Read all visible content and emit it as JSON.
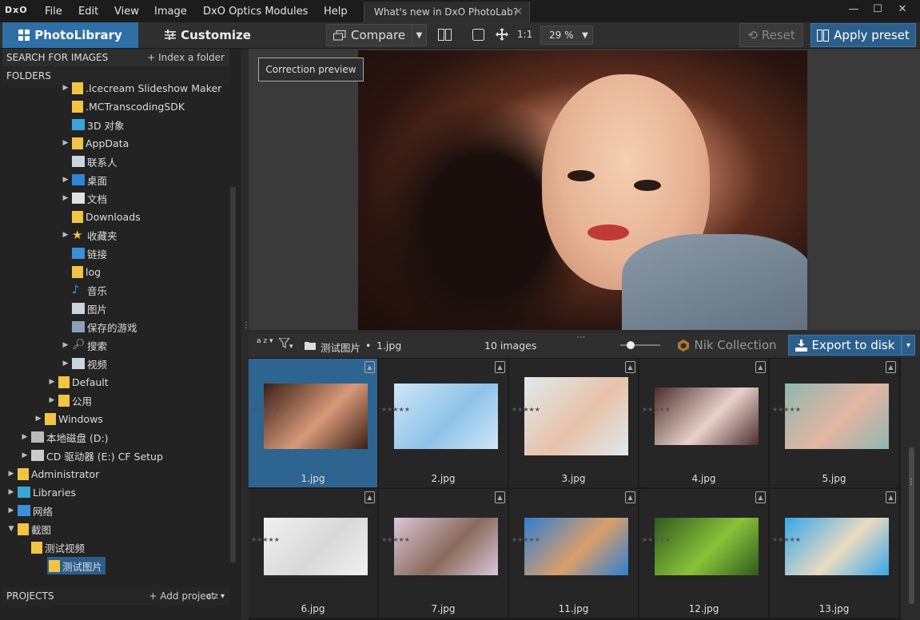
{
  "window": {
    "logo": "DxO",
    "menus": [
      "File",
      "Edit",
      "View",
      "Image",
      "DxO Optics Modules",
      "Help"
    ],
    "tab_title": "What's new in DxO PhotoLab?",
    "tab_close": "×",
    "controls": [
      "—",
      "☐",
      "✕"
    ]
  },
  "toolbar": {
    "library_label": "PhotoLibrary",
    "customize_label": "Customize",
    "compare_label": "Compare",
    "ratio_label": "1:1",
    "zoom_value": "29 %",
    "reset_label": "Reset",
    "apply_label": "Apply preset"
  },
  "left": {
    "search_label": "SEARCH FOR IMAGES",
    "index_label": "+ Index a folder",
    "folders_label": "FOLDERS",
    "projects_label": "PROJECTS",
    "add_project_label": "+ Add project",
    "sort_label": "a z ▾"
  },
  "tree": [
    {
      "label": ".Icecream Slideshow Maker",
      "indent": 5,
      "arrow": "▶",
      "icon": "folder"
    },
    {
      "label": ".MCTranscodingSDK",
      "indent": 5,
      "arrow": "",
      "icon": "folder"
    },
    {
      "label": "3D 对象",
      "indent": 5,
      "arrow": "",
      "icon": "cube"
    },
    {
      "label": "AppData",
      "indent": 5,
      "arrow": "▶",
      "icon": "folder"
    },
    {
      "label": "联系人",
      "indent": 5,
      "arrow": "",
      "icon": "contacts"
    },
    {
      "label": "桌面",
      "indent": 5,
      "arrow": "▶",
      "icon": "desktop"
    },
    {
      "label": "文档",
      "indent": 5,
      "arrow": "▶",
      "icon": "document"
    },
    {
      "label": "Downloads",
      "indent": 5,
      "arrow": "",
      "icon": "folder"
    },
    {
      "label": "收藏夹",
      "indent": 5,
      "arrow": "▶",
      "icon": "star"
    },
    {
      "label": "链接",
      "indent": 5,
      "arrow": "",
      "icon": "link"
    },
    {
      "label": "log",
      "indent": 5,
      "arrow": "",
      "icon": "folder"
    },
    {
      "label": "音乐",
      "indent": 5,
      "arrow": "",
      "icon": "music"
    },
    {
      "label": "图片",
      "indent": 5,
      "arrow": "",
      "icon": "picture"
    },
    {
      "label": "保存的游戏",
      "indent": 5,
      "arrow": "",
      "icon": "game"
    },
    {
      "label": "搜索",
      "indent": 5,
      "arrow": "▶",
      "icon": "search"
    },
    {
      "label": "视频",
      "indent": 5,
      "arrow": "▶",
      "icon": "video"
    },
    {
      "label": "Default",
      "indent": 4,
      "arrow": "▶",
      "icon": "folder"
    },
    {
      "label": "公用",
      "indent": 4,
      "arrow": "▶",
      "icon": "folder"
    },
    {
      "label": "Windows",
      "indent": 3,
      "arrow": "▶",
      "icon": "folder"
    },
    {
      "label": "本地磁盘 (D:)",
      "indent": 2,
      "arrow": "▶",
      "icon": "drive"
    },
    {
      "label": "CD 驱动器 (E:) CF Setup",
      "indent": 2,
      "arrow": "▶",
      "icon": "cd"
    },
    {
      "label": "Administrator",
      "indent": 1,
      "arrow": "▶",
      "icon": "folder"
    },
    {
      "label": "Libraries",
      "indent": 1,
      "arrow": "▶",
      "icon": "library"
    },
    {
      "label": "网络",
      "indent": 1,
      "arrow": "▶",
      "icon": "network"
    },
    {
      "label": "截图",
      "indent": 1,
      "arrow": "▼",
      "icon": "folder"
    },
    {
      "label": "测试视频",
      "indent": 2,
      "arrow": "",
      "icon": "folder"
    },
    {
      "label": "测试图片",
      "indent": 2,
      "arrow": "",
      "icon": "folder",
      "selected": true
    }
  ],
  "preview": {
    "correction_label": "Correction preview"
  },
  "strip": {
    "sort_label": "a z ▾",
    "filter_label": "▾",
    "path_folder": "测试图片",
    "path_sep": "•",
    "path_file": "1.jpg",
    "count_label": "10 images",
    "nik_label": "Nik Collection",
    "export_label": "Export to disk",
    "export_dd": "▾"
  },
  "images": [
    {
      "name": "1.jpg",
      "selected": true,
      "colors": [
        "#3a1f16",
        "#d89a7a"
      ]
    },
    {
      "name": "2.jpg",
      "colors": [
        "#cfe6f7",
        "#8ec2e8"
      ]
    },
    {
      "name": "3.jpg",
      "colors": [
        "#dfe9ee",
        "#e8c2a8"
      ]
    },
    {
      "name": "4.jpg",
      "colors": [
        "#4b2f2c",
        "#e9d2cc"
      ]
    },
    {
      "name": "5.jpg",
      "colors": [
        "#8fb7b0",
        "#e4b6a3"
      ]
    },
    {
      "name": "6.jpg",
      "colors": [
        "#f1f1f1",
        "#d8d8d8"
      ]
    },
    {
      "name": "7.jpg",
      "colors": [
        "#d9c6d9",
        "#8a6a5a"
      ]
    },
    {
      "name": "11.jpg",
      "colors": [
        "#2f7fd0",
        "#d9a06a"
      ]
    },
    {
      "name": "12.jpg",
      "colors": [
        "#2f5a1d",
        "#8ac23a"
      ]
    },
    {
      "name": "13.jpg",
      "colors": [
        "#38a6e8",
        "#e9dcc0"
      ]
    }
  ],
  "icons": {
    "lock": "lock-icon",
    "star": "star-icon"
  }
}
